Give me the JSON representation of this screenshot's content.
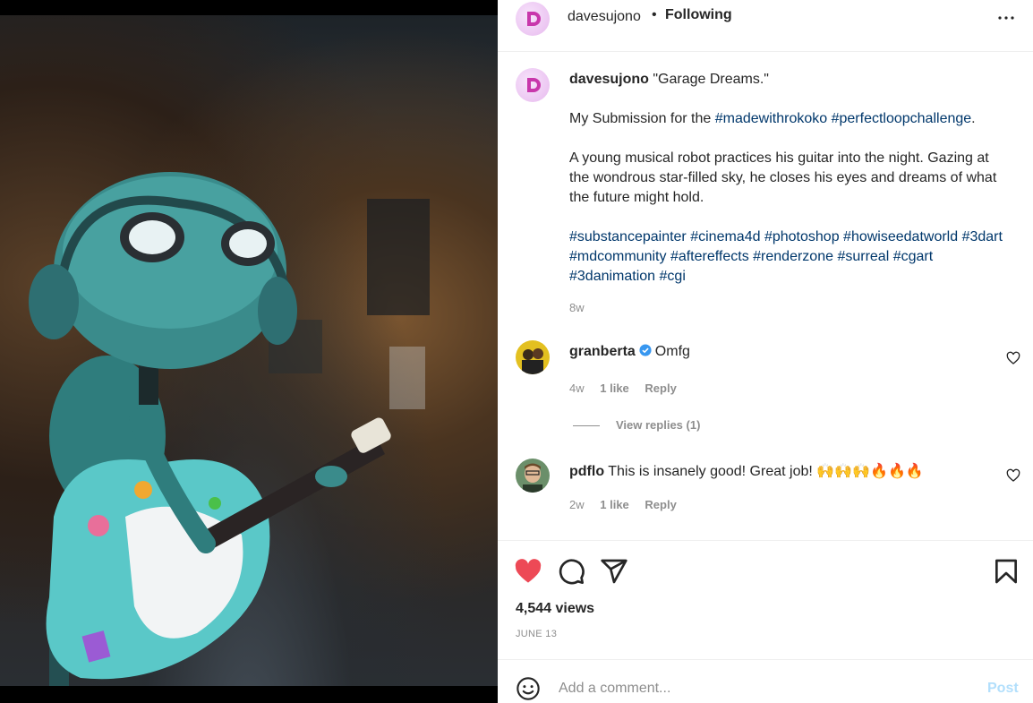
{
  "post": {
    "image_alt": "Teal robot with headphones playing a sticker-covered electric guitar in a garage",
    "header": {
      "username": "davesujono",
      "separator": "•",
      "follow_status": "Following"
    },
    "caption": {
      "username": "davesujono",
      "title": "\"Garage Dreams.\"",
      "line2_prefix": "My Submission for the",
      "line2_tags": [
        "#madewithrokoko",
        "#perfectloopchallenge"
      ],
      "line2_suffix": ".",
      "body": "A young musical robot practices his guitar into the night. Gazing at the wondrous star-filled sky, he closes his eyes and dreams of what the future might hold.",
      "hashtags": [
        "#substancepainter",
        "#cinema4d",
        "#photoshop",
        "#howiseedatworld",
        "#3dart",
        "#mdcommunity",
        "#aftereffects",
        "#renderzone",
        "#surreal",
        "#cgart",
        "#3danimation",
        "#cgi"
      ],
      "time": "8w"
    },
    "comments": [
      {
        "username": "granberta",
        "verified": true,
        "text": "Omfg",
        "time": "4w",
        "likes": "1 like",
        "reply": "Reply",
        "view_replies": "View replies (1)"
      },
      {
        "username": "pdflo",
        "verified": false,
        "text": "This is insanely good! Great job! 🙌🙌🙌🔥🔥🔥",
        "time": "2w",
        "likes": "1 like",
        "reply": "Reply"
      }
    ],
    "views": "4,544 views",
    "date": "JUNE 13",
    "add_comment": {
      "placeholder": "Add a comment...",
      "post_label": "Post"
    }
  },
  "colors": {
    "like_red": "#ed4956",
    "link_blue": "#00376b",
    "muted": "#8e8e8e",
    "post_disabled": "#b2dffc",
    "avatar_brand": "#c837ab"
  },
  "icons": {
    "more": "more-horizontal-icon",
    "like": "heart-filled-icon",
    "comment": "comment-icon",
    "share": "share-icon",
    "save": "bookmark-icon",
    "emoji": "emoji-icon",
    "verified": "verified-badge-icon"
  }
}
